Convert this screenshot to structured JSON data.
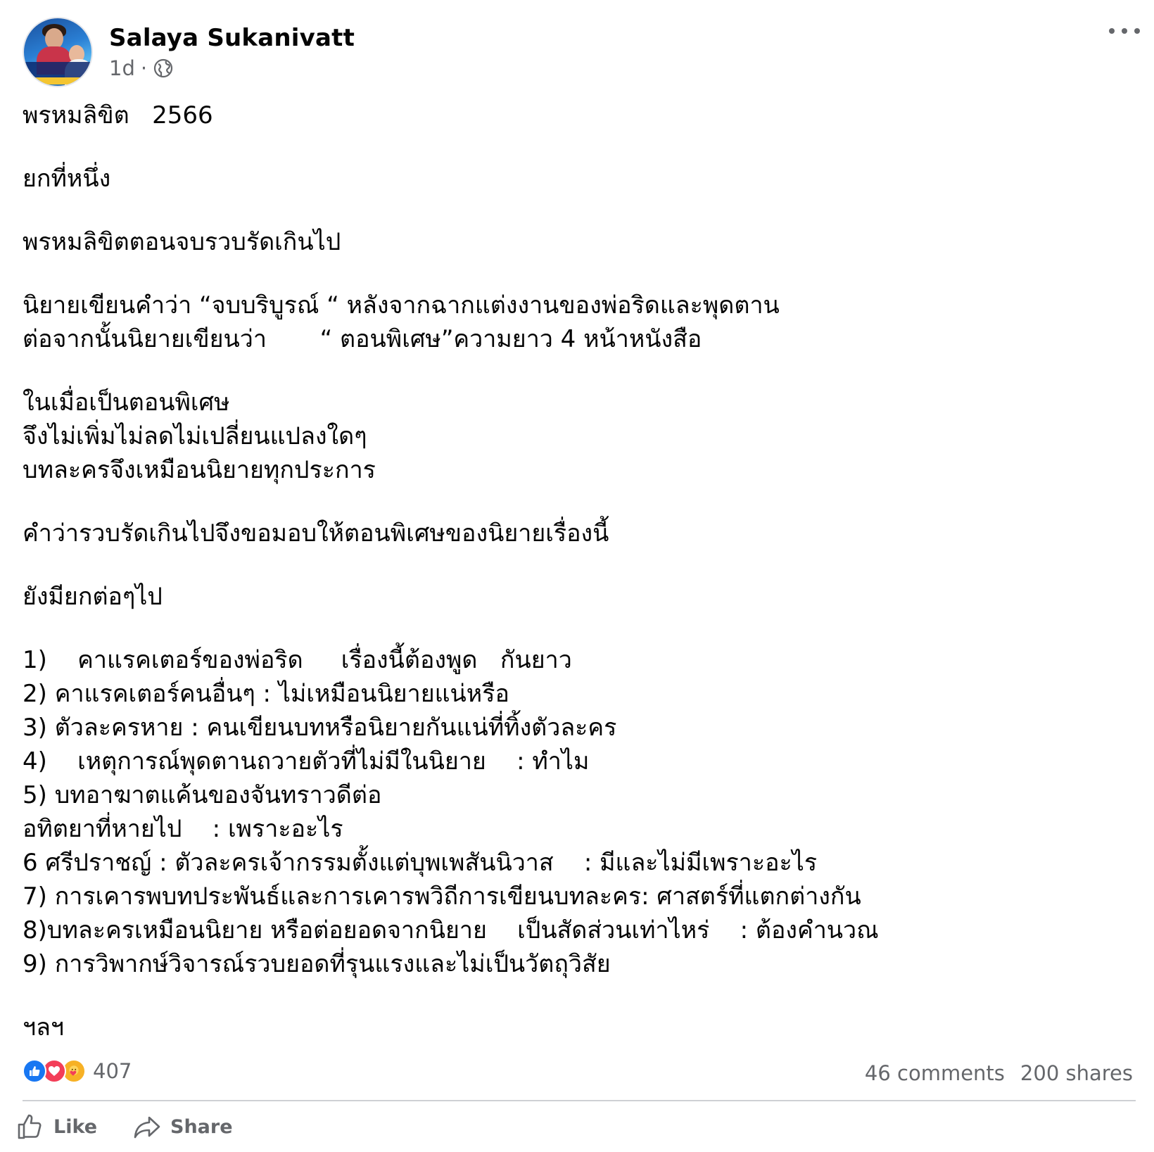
{
  "post": {
    "author": "Salaya Sukanivatt",
    "time": "1d",
    "separator": "·",
    "lines": [
      "พรหมลิขิต   2566",
      "",
      "ยกที่หนึ่ง",
      "",
      "พรหมลิขิตตอนจบรวบรัดเกินไป",
      "",
      "นิยายเขียนคำว่า “จบบริบูรณ์ “ หลังจากฉากแต่งงานของพ่อริดและพุดตาน",
      "ต่อจากนั้นนิยายเขียนว่า       “ ตอนพิเศษ”ความยาว 4 หน้าหนังสือ",
      "",
      "ในเมื่อเป็นตอนพิเศษ",
      "จึงไม่เพิ่มไม่ลดไม่เปลี่ยนแปลงใดๆ",
      "บทละครจึงเหมือนนิยายทุกประการ",
      "",
      "คำว่ารวบรัดเกินไปจึงขอมอบให้ตอนพิเศษของนิยายเรื่องนี้",
      "",
      "ยังมียกต่อๆไป",
      "",
      "1)    คาแรคเตอร์ของพ่อริด     เรื่องนี้ต้องพูด   กันยาว",
      "2) คาแรคเตอร์คนอื่นๆ : ไม่เหมือนนิยายแน่หรือ",
      "3) ตัวละครหาย : คนเขียนบทหรือนิยายกันแน่ที่ทิ้งตัวละคร",
      "4)    เหตุการณ์พุดตานถวายตัวที่ไม่มีในนิยาย    : ทำไม",
      "5) บทอาฆาตแค้นของจันทราวดีต่อ",
      "อทิตยาที่หายไป    : เพราะอะไร",
      "6 ศรีปราชญ์ : ตัวละครเจ้ากรรมตั้งแต่บุพเพสันนิวาส    : มีและไม่มีเพราะอะไร",
      "7) การเคารพบทประพันธ์และการเคารพวิถีการเขียนบทละคร: ศาสตร์ที่แตกต่างกัน",
      "8)บทละครเหมือนนิยาย หรือต่อยอดจากนิยาย    เป็นสัดส่วนเท่าไหร่    : ต้องคำนวณ",
      "9) การวิพากษ์วิจารณ์รวบยอดที่รุนแรงและไม่เป็นวัตถุวิสัย",
      "",
      "ฯลฯ"
    ]
  },
  "reactions": {
    "icons": [
      "like-icon",
      "love-icon",
      "care-icon"
    ],
    "count": "407",
    "comments": "46 comments",
    "shares": "200 shares"
  },
  "actions": {
    "like_label": "Like",
    "share_label": "Share"
  },
  "colors": {
    "text": "#050505",
    "secondary": "#65676b",
    "like_blue": "#1877f2",
    "love_red": "#f33e58",
    "care_yellow": "#f7b125"
  }
}
